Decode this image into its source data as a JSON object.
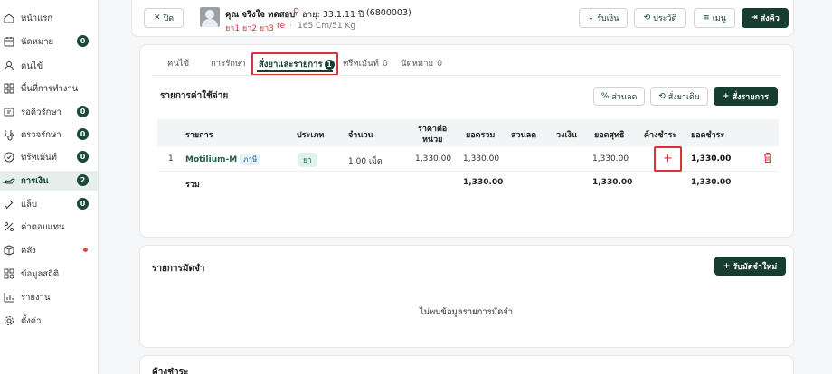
{
  "sidebar": {
    "items": [
      {
        "label": "หน้าแรก",
        "icon": "home-icon"
      },
      {
        "label": "นัดหมาย",
        "icon": "calendar-icon",
        "badge": "0"
      },
      {
        "label": "คนไข้",
        "icon": "user-icon"
      },
      {
        "label": "พื้นที่การทำงาน",
        "icon": "grid-icon"
      },
      {
        "label": "รอคิวรักษา",
        "icon": "queue-icon",
        "badge": "0"
      },
      {
        "label": "ตรวจรักษา",
        "icon": "stethoscope-icon",
        "badge": "0"
      },
      {
        "label": "ทรีทเม้นท์",
        "icon": "treatment-icon",
        "badge": "0"
      },
      {
        "label": "การเงิน",
        "icon": "money-icon",
        "badge": "2",
        "active": true
      },
      {
        "label": "แล็บ",
        "icon": "lab-icon",
        "badge": "0"
      },
      {
        "label": "ค่าตอบแทน",
        "icon": "percent-icon"
      },
      {
        "label": "คลัง",
        "icon": "box-icon",
        "dot": true
      },
      {
        "label": "ข้อมูลสถิติ",
        "icon": "stats-icon"
      },
      {
        "label": "รายงาน",
        "icon": "report-icon"
      },
      {
        "label": "ตั้งค่า",
        "icon": "gear-icon"
      }
    ]
  },
  "header": {
    "close_label": "ปิด",
    "patient_name": "คุณ จริงใจ ทดสอบ",
    "age": "อายุ: 33.1.11 ปี",
    "hn": "(6800003)",
    "allergies": "ยา1 ยา2 ยา3",
    "allergy_sep": "·",
    "allergy_extra": "re",
    "vitals": "165 Cm/51 Kg",
    "receive_money_label": "รับเงิน",
    "history_label": "ประวัติ",
    "menu_label": "เมนู",
    "send_queue_label": "ส่งคิว"
  },
  "tabs": [
    {
      "label": "คนไข้"
    },
    {
      "label": "การรักษา"
    },
    {
      "label": "สั่งยาและรายการ",
      "badge": "1",
      "active": true
    },
    {
      "label": "ทรีทเม้นท์",
      "count": "0"
    },
    {
      "label": "นัดหมาย",
      "count": "0"
    }
  ],
  "expenses": {
    "title": "รายการค่าใช้จ่าย",
    "discount_label": "ส่วนลด",
    "old_order_label": "สั่งยาเดิม",
    "add_order_label": "สั่งรายการ",
    "columns": [
      "รายการ",
      "ประเภท",
      "จำนวน",
      "ราคาต่อ",
      "หน่วย",
      "ยอดรวม",
      "ส่วนลด",
      "วงเงิน",
      "ยอดสุทธิ",
      "ค้างชำระ",
      "ยอดชำระ"
    ],
    "rows": [
      {
        "no": "1",
        "name": "Motilium-M",
        "tag": "ภาษี",
        "type": "ยา",
        "qty": "1.00 เม็ด",
        "unit_price": "1,330.00",
        "total": "1,330.00",
        "discount": "",
        "limit": "",
        "net": "1,330.00",
        "outstanding_action": "+",
        "paid": "1,330.00"
      }
    ],
    "summary": {
      "label": "รวม",
      "total": "1,330.00",
      "net": "1,330.00",
      "paid": "1,330.00"
    }
  },
  "deposit": {
    "title": "รายการมัดจำ",
    "add_label": "รับมัดจำใหม่",
    "empty_text": "ไม่พบข้อมูลรายการมัดจำ"
  },
  "outstanding": {
    "title": "ค้างชำระ"
  },
  "colors": {
    "primary": "#173d31",
    "highlight_border": "#d9343a",
    "allergy": "#d9343a"
  }
}
